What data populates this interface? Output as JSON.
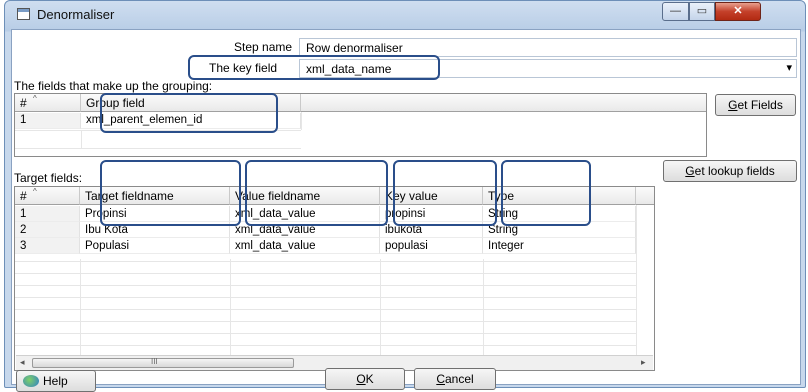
{
  "window": {
    "title": "Denormaliser",
    "controls": {
      "min": "—",
      "max": "▭",
      "close": "✕"
    }
  },
  "step": {
    "label": "Step name",
    "value": "Row denormaliser"
  },
  "key": {
    "label": "The key field",
    "value": "xml_data_name",
    "dropdown": "▾"
  },
  "grouping": {
    "label": "The fields that make up the grouping:",
    "headers": [
      "#",
      "Group field"
    ],
    "rows": [
      [
        "1",
        "xml_parent_elemen_id"
      ]
    ],
    "button_key": "G",
    "button_rest": "et Fields"
  },
  "target": {
    "label": "Target fields:",
    "headers": [
      "#",
      "Target fieldname",
      "Value fieldname",
      "Key value",
      "Type"
    ],
    "rows": [
      [
        "1",
        "Propinsi",
        "xml_data_value",
        "propinsi",
        "String"
      ],
      [
        "2",
        "Ibu Kota",
        "xml_data_value",
        "ibukota",
        "String"
      ],
      [
        "3",
        "Populasi",
        "xml_data_value",
        "populasi",
        "Integer"
      ]
    ],
    "button_key": "G",
    "button_rest": "et lookup fields",
    "scroll_grip": "III",
    "scroll_left": "◂",
    "scroll_right": "▸"
  },
  "footer": {
    "help": "Help",
    "ok_key": "O",
    "ok_rest": "K",
    "cancel_key": "C",
    "cancel_rest": "ancel"
  }
}
